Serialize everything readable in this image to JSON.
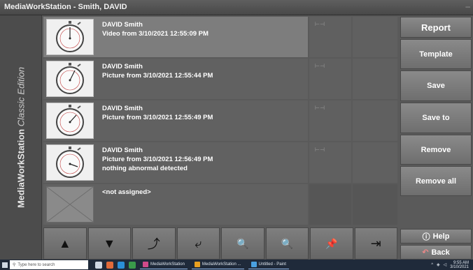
{
  "window": {
    "title": "MediaWorkStation - Smith, DAVID",
    "min_glyph": "–"
  },
  "brand": {
    "name": "MediaWorkStation",
    "edition": "Classic Edition"
  },
  "items": [
    {
      "name": "DAVID Smith",
      "desc": "Video from 3/10/2021 12:55:09 PM",
      "note": "",
      "thumb": "stopwatch-icon",
      "selected": true
    },
    {
      "name": "DAVID Smith",
      "desc": "Picture from 3/10/2021 12:55:44 PM",
      "note": "",
      "thumb": "stopwatch-icon",
      "selected": false
    },
    {
      "name": "DAVID Smith",
      "desc": "Picture from 3/10/2021 12:55:49 PM",
      "note": "",
      "thumb": "stopwatch-icon",
      "selected": false
    },
    {
      "name": "DAVID Smith",
      "desc": "Picture from 3/10/2021 12:56:49 PM",
      "note": "nothing abnormal detected",
      "thumb": "stopwatch-icon",
      "selected": false
    },
    {
      "name": "<not assigned>",
      "desc": "",
      "note": "",
      "thumb": "empty-slot-icon",
      "selected": false
    }
  ],
  "buttons": {
    "report": "Report",
    "template": "Template",
    "save": "Save",
    "save_to": "Save to",
    "remove": "Remove",
    "remove_all": "Remove all",
    "help": "Help",
    "back": "Back"
  },
  "toolbar": [
    {
      "name": "move-up-icon",
      "glyph": "▲",
      "enabled": true
    },
    {
      "name": "move-down-icon",
      "glyph": "▼",
      "enabled": true
    },
    {
      "name": "rotate-right-icon",
      "glyph": "⤴",
      "enabled": true
    },
    {
      "name": "rotate-left-icon",
      "glyph": "⤶",
      "enabled": true
    },
    {
      "name": "zoom-in-icon",
      "glyph": "🔍",
      "enabled": true
    },
    {
      "name": "zoom-out-icon",
      "glyph": "🔍",
      "enabled": false
    },
    {
      "name": "pin-icon",
      "glyph": "📌",
      "enabled": true
    },
    {
      "name": "fit-width-icon",
      "glyph": "⇥",
      "enabled": true
    }
  ],
  "taskbar": {
    "search_placeholder": "Type here to search",
    "apps": [
      "MediaWorkStation",
      "MediaWorkStation ...",
      "Untitled - Paint"
    ],
    "time": "9:55 AM",
    "date": "3/10/2021"
  },
  "colors": {
    "background": "#5a5a5a",
    "selected_row": "#7d7d7d",
    "button": "#7a7a7a"
  }
}
